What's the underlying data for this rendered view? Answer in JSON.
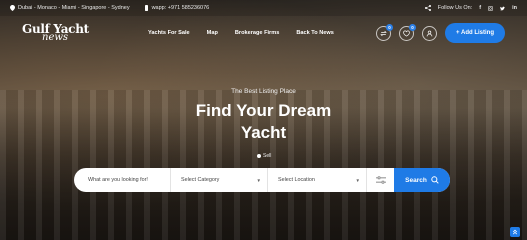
{
  "topbar": {
    "locations": "Dubai - Monaco - Miami - Singapore - Sydney",
    "phone": "wapp: +971 585236076",
    "follow_label": "Follow Us On:"
  },
  "header": {
    "logo_line1": "Gulf Yacht",
    "logo_line2": "news",
    "menu": [
      "Yachts For Sale",
      "Map",
      "Brokerage Firms",
      "Back To News"
    ],
    "compare_count": "0",
    "wishlist_count": "0",
    "add_listing_label": "+ Add Listing"
  },
  "hero": {
    "eyebrow": "The Best Listing Place",
    "title_line1": "Find Your Dream",
    "title_line2": "Yacht",
    "slider_label": "Sell"
  },
  "search": {
    "keyword_placeholder": "What are you looking for!",
    "category_value": "Select Category",
    "location_value": "Select Location",
    "button_label": "Search"
  },
  "colors": {
    "accent": "#1f7be6"
  }
}
